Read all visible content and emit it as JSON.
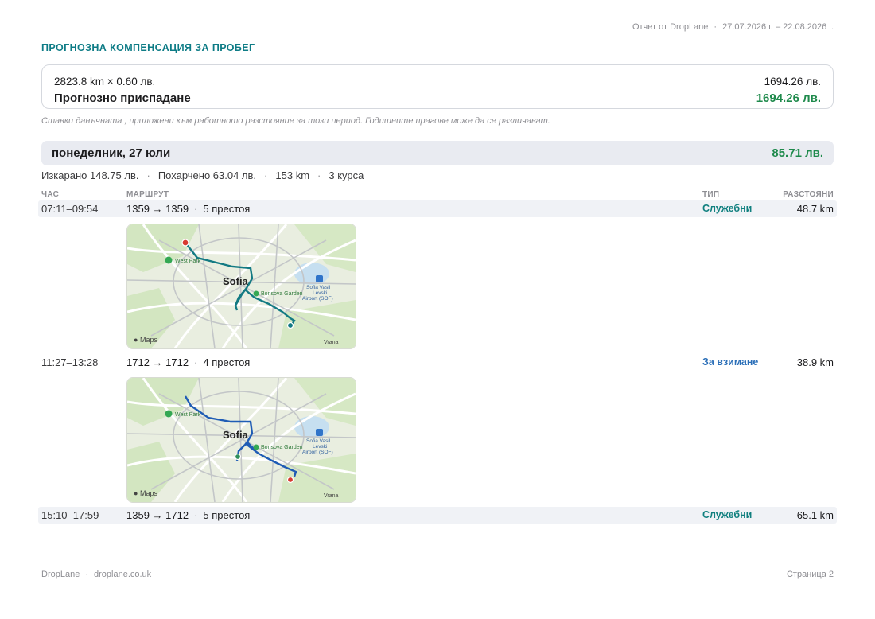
{
  "header": {
    "report_label": "Отчет от DropLane",
    "period": "27.07.2026 г. – 22.08.2026 г."
  },
  "section_title": "ПРОГНОЗНА КОМПЕНСАЦИЯ ЗА ПРОБЕГ",
  "summary": {
    "formula": "2823.8 km × 0.60 лв.",
    "formula_value": "1694.26 лв.",
    "label": "Прогнозно приспадане",
    "total": "1694.26 лв."
  },
  "note": "Ставки данъчната , приложени към работното разстояние за този период. Годишните прагове може да се различават.",
  "day": {
    "title": "понеделник, 27 юли",
    "total": "85.71 лв.",
    "earned": "Изкарано 148.75 лв.",
    "spent": "Похарчено 63.04 лв.",
    "distance": "153 km",
    "trips": "3 курса"
  },
  "columns": {
    "time": "ЧАС",
    "route": "МАРШРУТ",
    "type": "ТИП",
    "distance": "РАЗСТОЯНИ"
  },
  "trips": [
    {
      "time": "07:11–09:54",
      "route": "1359 → 1359",
      "stops": "5 престоя",
      "type": "Служебни",
      "distance": "48.7 km"
    },
    {
      "time": "11:27–13:28",
      "route": "1712 → 1712",
      "stops": "4 престоя",
      "type": "За взимане",
      "distance": "38.9 km"
    },
    {
      "time": "15:10–17:59",
      "route": "1359 → 1712",
      "stops": "5 престоя",
      "type": "Служебни",
      "distance": "65.1 km"
    }
  ],
  "map": {
    "city": "Sofia",
    "park": "West Park",
    "garden": "Borisova Garden",
    "airport_line1": "Sofia Vasil",
    "airport_line2": "Levski",
    "airport_line3": "Airport (SOF)",
    "brand": "Maps",
    "corner": "Vrana"
  },
  "colors": {
    "accent": "#0e7c86",
    "money_green": "#1f8a4c",
    "pickup_blue": "#2b6fb8",
    "route_teal": "#137a83",
    "route_blue": "#1f5cb5"
  },
  "footer": {
    "brand": "DropLane",
    "url": "droplane.co.uk",
    "page": "Страница 2"
  }
}
